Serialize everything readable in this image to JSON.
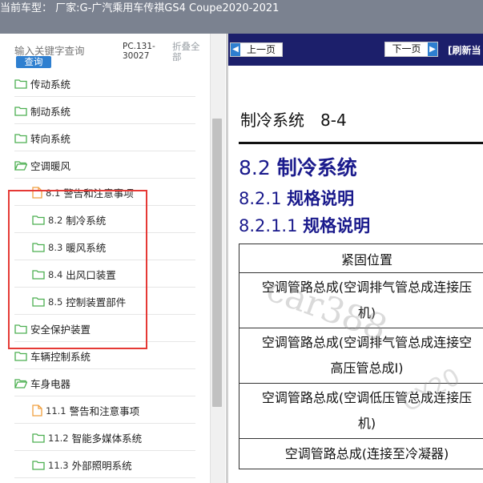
{
  "title_bar": {
    "text": "当前车型： 厂家:G-广汽乘用车传祺GS4 Coupe2020-2021"
  },
  "search": {
    "placeholder": "输入关键字查询",
    "button_label": "查询"
  },
  "pc_code": "PC.131-30027",
  "collapse_all_label": "折叠全部",
  "tree": [
    {
      "label": "传动系统",
      "level": 1,
      "icon": "folder-icon"
    },
    {
      "label": "制动系统",
      "level": 1,
      "icon": "folder-icon"
    },
    {
      "label": "转向系统",
      "level": 1,
      "icon": "folder-icon"
    },
    {
      "label": "空调暖风",
      "level": 1,
      "icon": "folder-open-icon"
    },
    {
      "num": "8.1",
      "label": "警告和注意事项",
      "level": 2,
      "icon": "document-icon"
    },
    {
      "num": "8.2",
      "label": "制冷系统",
      "level": 2,
      "icon": "folder-icon"
    },
    {
      "num": "8.3",
      "label": "暖风系统",
      "level": 2,
      "icon": "folder-icon"
    },
    {
      "num": "8.4",
      "label": "出风口装置",
      "level": 2,
      "icon": "folder-icon"
    },
    {
      "num": "8.5",
      "label": "控制装置部件",
      "level": 2,
      "icon": "folder-icon"
    },
    {
      "label": "安全保护装置",
      "level": 1,
      "icon": "folder-icon"
    },
    {
      "label": "车辆控制系统",
      "level": 1,
      "icon": "folder-icon"
    },
    {
      "label": "车身电器",
      "level": 1,
      "icon": "folder-open-icon"
    },
    {
      "num": "11.1",
      "label": "警告和注意事项",
      "level": 2,
      "icon": "document-icon"
    },
    {
      "num": "11.2",
      "label": "智能多媒体系统",
      "level": 2,
      "icon": "folder-icon"
    },
    {
      "num": "11.3",
      "label": "外部照明系统",
      "level": 2,
      "icon": "folder-icon"
    }
  ],
  "doc_nav": {
    "prev_label": "上一页",
    "next_label": "下一页",
    "refresh_label": "[刷新当"
  },
  "doc": {
    "page_title": "制冷系统　8-4",
    "h1_num": "8.2",
    "h1_text": "制冷系统",
    "h2_num": "8.2.1",
    "h2_text": "规格说明",
    "h3_num": "8.2.1.1",
    "h3_text": "规格说明",
    "table_header": "紧固位置",
    "rows": [
      {
        "line1": "空调管路总成(空调排气管总成连接压",
        "line2": "机)"
      },
      {
        "line1": "空调管路总成(空调排气管总成连接空",
        "line2": "高压管总成I)"
      },
      {
        "line1": "空调管路总成(空调低压管总成连接压",
        "line2": "机)"
      },
      {
        "line1": "空调管路总成(连接至冷凝器)",
        "line2": ""
      }
    ]
  },
  "watermark": {
    "text1": "car388",
    "text2": "CY20"
  },
  "colors": {
    "title_bar_bg": "#7b8290",
    "nav_bar_bg": "#1c1f6b",
    "heading_blue": "#1a1a8c",
    "highlight_red": "#e53935",
    "button_blue": "#2e7fd0",
    "folder_green": "#4caf50",
    "doc_orange": "#f0a040"
  }
}
